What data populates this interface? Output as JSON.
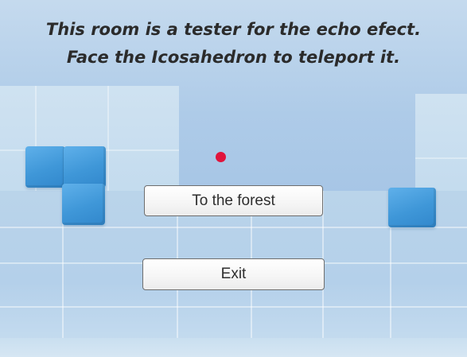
{
  "hud": {
    "message_line_1": "This room is a tester for the echo efect.",
    "message_line_2": "Face the Icosahedron to teleport it."
  },
  "menu": {
    "forest_button_label": "To the forest",
    "exit_button_label": "Exit"
  },
  "colors": {
    "reticle": "#e0143c",
    "cube": "#3f97d8",
    "sky_wall": "#aecbe8"
  }
}
